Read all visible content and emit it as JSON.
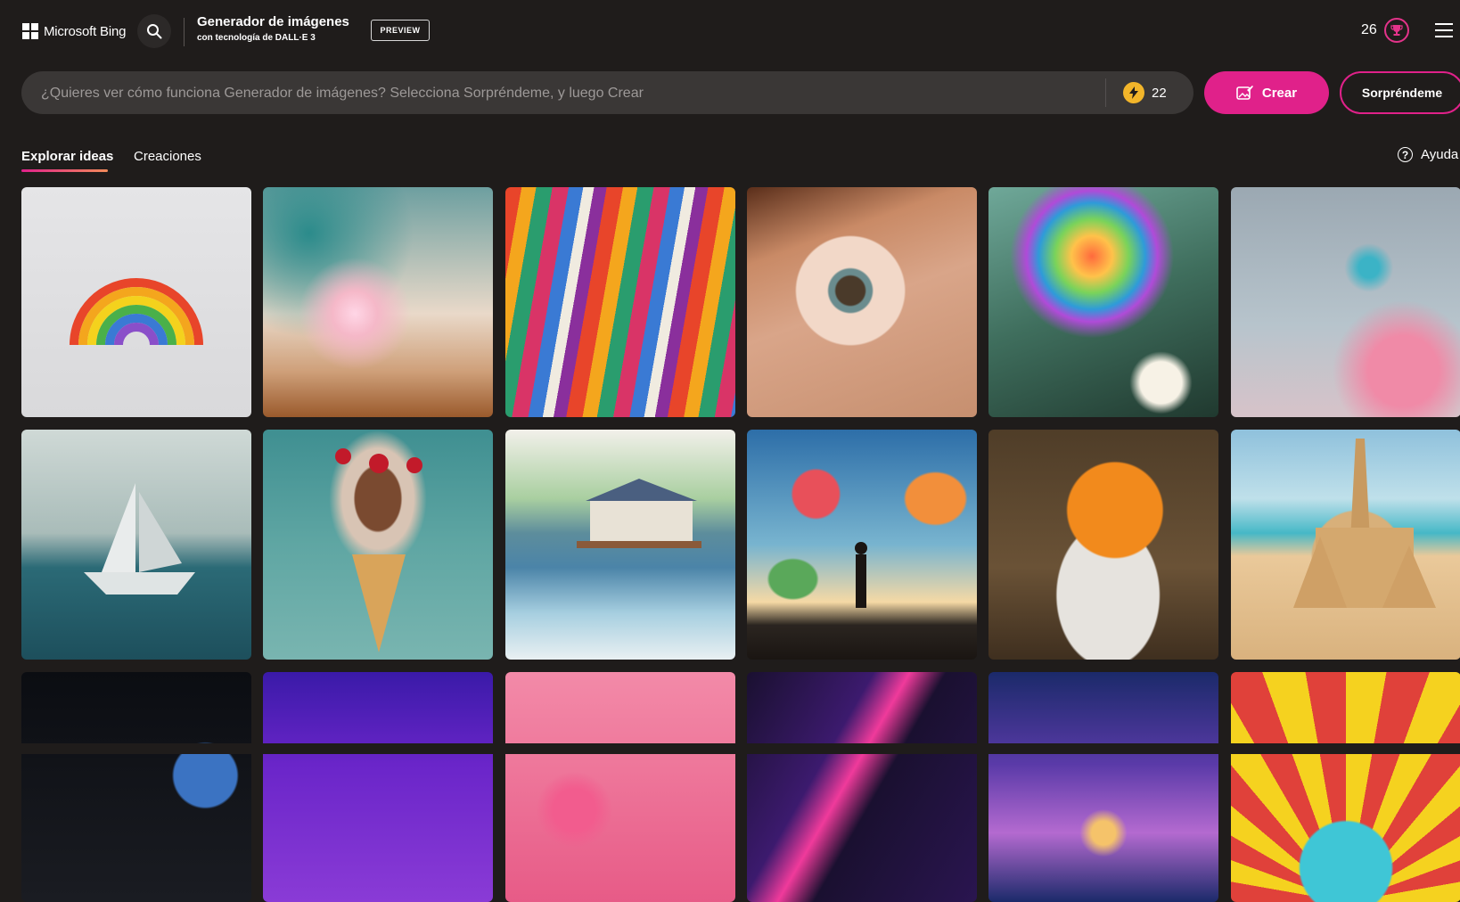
{
  "header": {
    "brand": "Microsoft Bing",
    "title": "Generador de imágenes",
    "subtitle": "con tecnología de DALL·E 3",
    "badge": "PREVIEW",
    "rewards_points": "26"
  },
  "prompt": {
    "placeholder": "¿Quieres ver cómo funciona Generador de imágenes? Selecciona Sorpréndeme, y luego Crear",
    "boosts": "22"
  },
  "actions": {
    "create_label": "Crear",
    "surprise_label": "Sorpréndeme"
  },
  "tabs": {
    "explore": "Explorar ideas",
    "creations": "Creaciones"
  },
  "help_label": "Ayuda",
  "icons": {
    "search": "search-icon",
    "rewards": "trophy-icon",
    "menu": "hamburger-icon",
    "boost": "lightning-icon",
    "create": "image-create-icon",
    "help": "question-circle-icon"
  },
  "colors": {
    "accent": "#e0218a",
    "background": "#1f1c1b",
    "prompt_bg": "#3a3736",
    "boost": "#f2b52a"
  }
}
